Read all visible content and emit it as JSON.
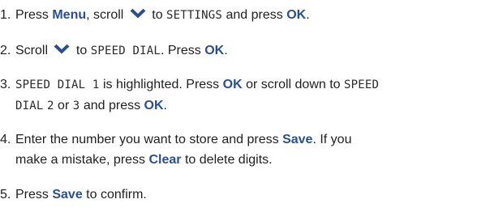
{
  "steps": [
    {
      "n": "1.",
      "a": "Press ",
      "menu": "Menu",
      "b": ", scroll ",
      "icon": "scroll-down-chevron",
      "c": " to ",
      "settings": "SETTINGS",
      "d": " and press ",
      "ok": "OK",
      "e": "."
    },
    {
      "n": "2.",
      "a": "Scroll ",
      "icon": "scroll-down-chevron",
      "b": " to ",
      "speed_dial": "SPEED DIAL",
      "c": ". Press ",
      "ok": "OK",
      "d": "."
    },
    {
      "n": "3.",
      "sd1": "SPEED DIAL 1",
      "a": " is highlighted. Press ",
      "ok1": "OK",
      "b": " or scroll down to ",
      "sd_speed": "SPEED",
      "sd_dial": "DIAL",
      "two": "2",
      "c": " or ",
      "three": "3",
      "d": " and press ",
      "ok2": "OK",
      "e": "."
    },
    {
      "n": "4.",
      "a": "Enter the number you want to store and press ",
      "save": "Save",
      "b": ". If you",
      "c": "make a mistake, press ",
      "clear": "Clear",
      "d": " to delete digits."
    },
    {
      "n": "5.",
      "a": "Press ",
      "save": "Save",
      "b": " to confirm."
    }
  ],
  "colors": {
    "key": "#2b4f8e",
    "text": "#1f1f1f"
  }
}
